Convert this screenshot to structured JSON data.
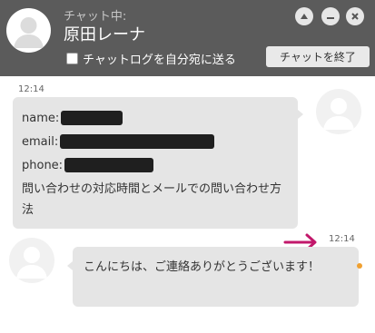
{
  "header": {
    "status_label": "チャット中:",
    "agent_name": "原田レーナ",
    "transcript_label": "チャットログを自分宛に送る",
    "transcript_checked": false,
    "end_chat_label": "チャットを終了"
  },
  "messages": [
    {
      "time": "12:14",
      "side": "visitor",
      "fields": [
        {
          "label": "name:"
        },
        {
          "label": "email:"
        },
        {
          "label": "phone:"
        }
      ],
      "text": "問い合わせの対応時間とメールでの問い合わせ方法"
    },
    {
      "time": "12:14",
      "side": "agent",
      "text": "こんにちは、ご連絡ありがとうございます！"
    }
  ],
  "colors": {
    "header_bg": "#5b5b5b",
    "bubble_bg": "#e5e5e5",
    "arrow": "#c2186b",
    "unread_dot": "#f0a030"
  }
}
